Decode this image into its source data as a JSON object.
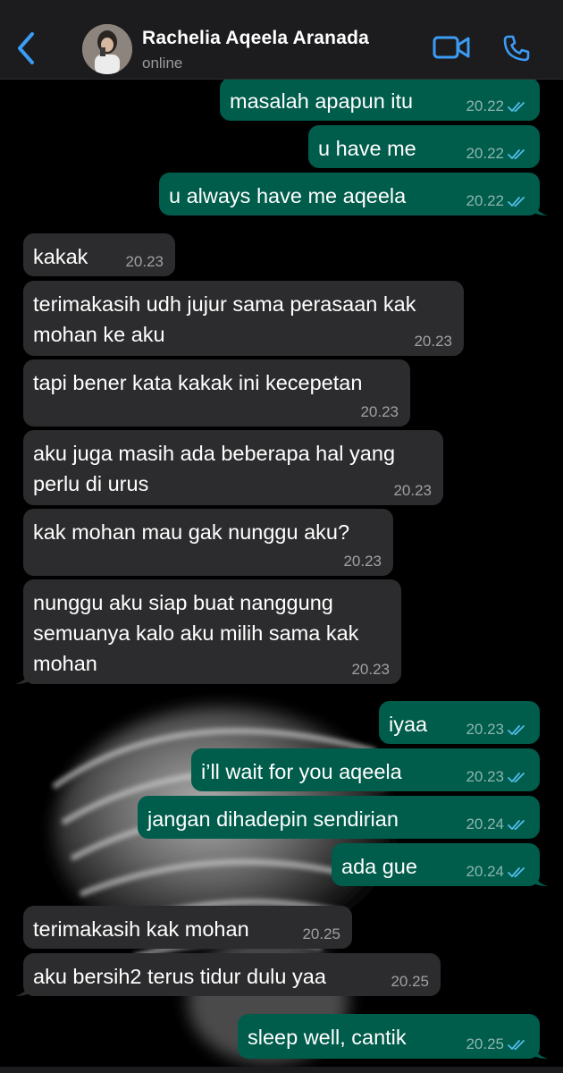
{
  "header": {
    "back_icon": "chevron-left-icon",
    "contact_name": "Rachelia Aqeela Aranada",
    "status": "online",
    "video_icon": "video-camera-icon",
    "call_icon": "phone-icon"
  },
  "colors": {
    "accent": "#3b9cf5",
    "outgoing_bubble": "#005c4b",
    "incoming_bubble": "#2c2c2e",
    "read_ticks": "#53bdeb"
  },
  "messages": [
    {
      "dir": "out",
      "lines": [
        "masalah apapun itu"
      ],
      "time": "20.22",
      "read": true
    },
    {
      "dir": "out",
      "lines": [
        "u have me"
      ],
      "time": "20.22",
      "read": true
    },
    {
      "dir": "out",
      "lines": [
        "u always have me aqeela"
      ],
      "time": "20.22",
      "read": true
    },
    {
      "dir": "in",
      "lines": [
        "kakak"
      ],
      "time": "20.23"
    },
    {
      "dir": "in",
      "lines": [
        "terimakasih udh jujur sama perasaan kak",
        "mohan ke aku"
      ],
      "time": "20.23"
    },
    {
      "dir": "in",
      "lines": [
        "tapi bener kata kakak ini kecepetan"
      ],
      "time": "20.23"
    },
    {
      "dir": "in",
      "lines": [
        "aku juga masih ada beberapa hal yang",
        "perlu di urus"
      ],
      "time": "20.23"
    },
    {
      "dir": "in",
      "lines": [
        "kak mohan mau gak nunggu aku?"
      ],
      "time": "20.23"
    },
    {
      "dir": "in",
      "lines": [
        "nunggu aku siap buat nanggung",
        "semuanya kalo aku milih sama kak",
        "mohan"
      ],
      "time": "20.23"
    },
    {
      "dir": "out",
      "lines": [
        "iyaa"
      ],
      "time": "20.23",
      "read": true
    },
    {
      "dir": "out",
      "lines": [
        "i’ll wait for you aqeela"
      ],
      "time": "20.23",
      "read": true
    },
    {
      "dir": "out",
      "lines": [
        "jangan dihadepin sendirian"
      ],
      "time": "20.24",
      "read": true
    },
    {
      "dir": "out",
      "lines": [
        "ada gue"
      ],
      "time": "20.24",
      "read": true
    },
    {
      "dir": "in",
      "lines": [
        "terimakasih kak mohan"
      ],
      "time": "20.25"
    },
    {
      "dir": "in",
      "lines": [
        "aku bersih2 terus tidur dulu yaa"
      ],
      "time": "20.25"
    },
    {
      "dir": "out",
      "lines": [
        "sleep well, cantik"
      ],
      "time": "20.25",
      "read": true
    }
  ]
}
